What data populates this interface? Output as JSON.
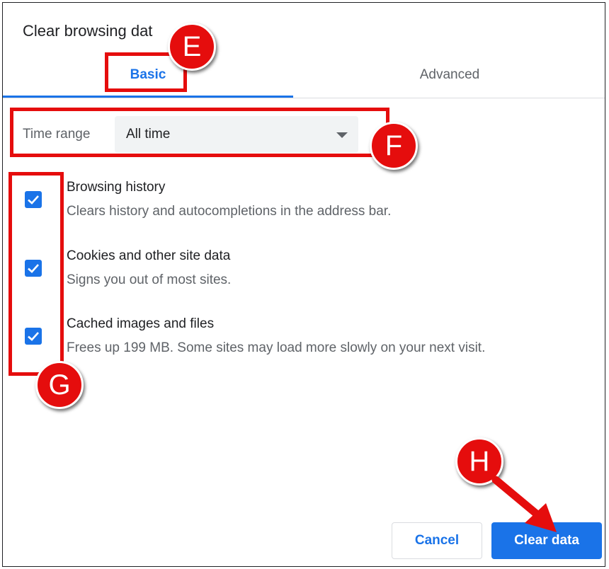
{
  "dialog": {
    "title": "Clear browsing dat"
  },
  "tabs": [
    {
      "label": "Basic",
      "active": true
    },
    {
      "label": "Advanced",
      "active": false
    }
  ],
  "time_range": {
    "label": "Time range",
    "value": "All time"
  },
  "options": [
    {
      "title": "Browsing history",
      "description": "Clears history and autocompletions in the address bar.",
      "checked": true
    },
    {
      "title": "Cookies and other site data",
      "description": "Signs you out of most sites.",
      "checked": true
    },
    {
      "title": "Cached images and files",
      "description": "Frees up 199 MB. Some sites may load more slowly on your next visit.",
      "checked": true
    }
  ],
  "buttons": {
    "cancel": "Cancel",
    "clear": "Clear data"
  },
  "annotations": {
    "e": "E",
    "f": "F",
    "g": "G",
    "h": "H"
  },
  "colors": {
    "accent": "#1a73e8",
    "annotation": "#e50d0d",
    "text": "#202124",
    "secondary_text": "#5f6368"
  },
  "icons": {
    "dropdown": "chevron-down-icon",
    "checkbox": "check-icon"
  }
}
